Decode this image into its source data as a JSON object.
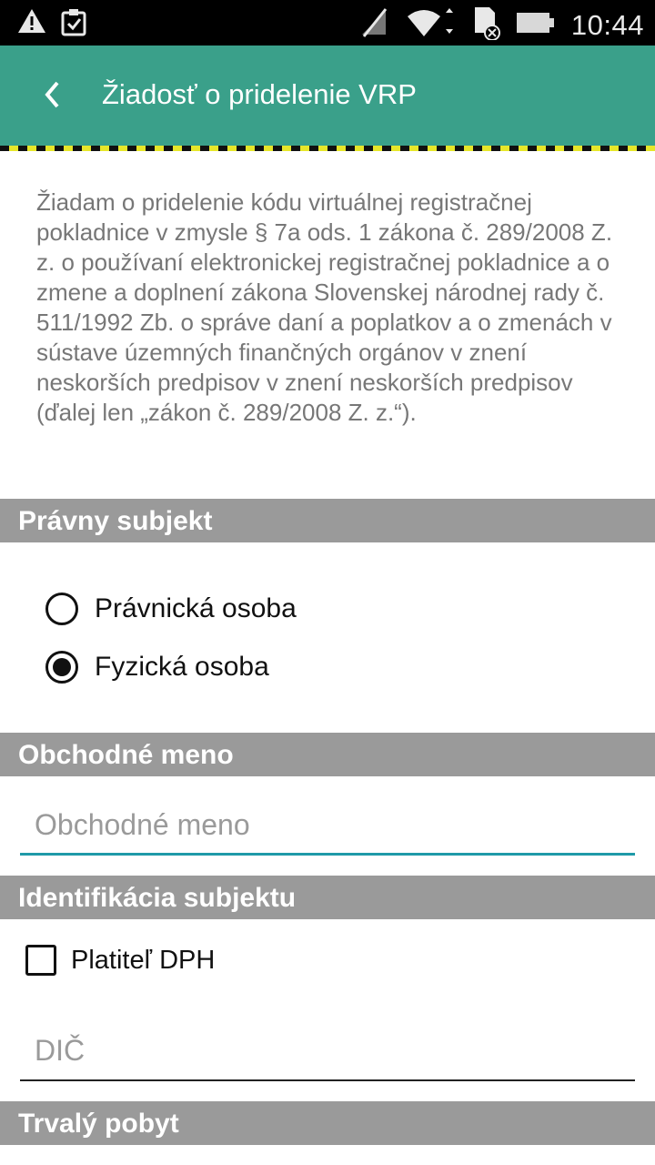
{
  "status_bar": {
    "time": "10:44",
    "icons": [
      "warning-icon",
      "clipboard-check-icon",
      "signal-off-icon",
      "wifi-icon",
      "sd-card-error-icon",
      "battery-icon"
    ]
  },
  "app_bar": {
    "title": "Žiadosť o pridelenie VRP",
    "back_icon": "chevron-left-icon",
    "background": "#3aa08a"
  },
  "intro_text": "Žiadam o pridelenie kódu virtuálnej registračnej pokladnice v zmysle § 7a ods. 1 zákona č. 289/2008 Z. z. o používaní elektronickej registračnej pokladnice a o zmene a doplnení zákona Slovenskej národnej rady č. 511/1992 Zb. o správe daní a poplatkov a o zmenách v sústave územných finančných orgánov v znení neskorších predpisov v znení neskorších predpisov (ďalej len „zákon č. 289/2008 Z. z.“).",
  "sections": {
    "legal_subject": {
      "title": "Právny subjekt",
      "options": [
        {
          "label": "Právnická osoba",
          "selected": false
        },
        {
          "label": "Fyzická osoba",
          "selected": true
        }
      ]
    },
    "business_name": {
      "title": "Obchodné meno",
      "input_value": "",
      "input_placeholder": "Obchodné meno"
    },
    "subject_identification": {
      "title": "Identifikácia subjektu",
      "vat_payer_label": "Platiteľ DPH",
      "vat_payer_checked": false,
      "dic_value": "",
      "dic_placeholder": "DIČ"
    },
    "permanent_residence": {
      "title": "Trvalý pobyt"
    }
  }
}
